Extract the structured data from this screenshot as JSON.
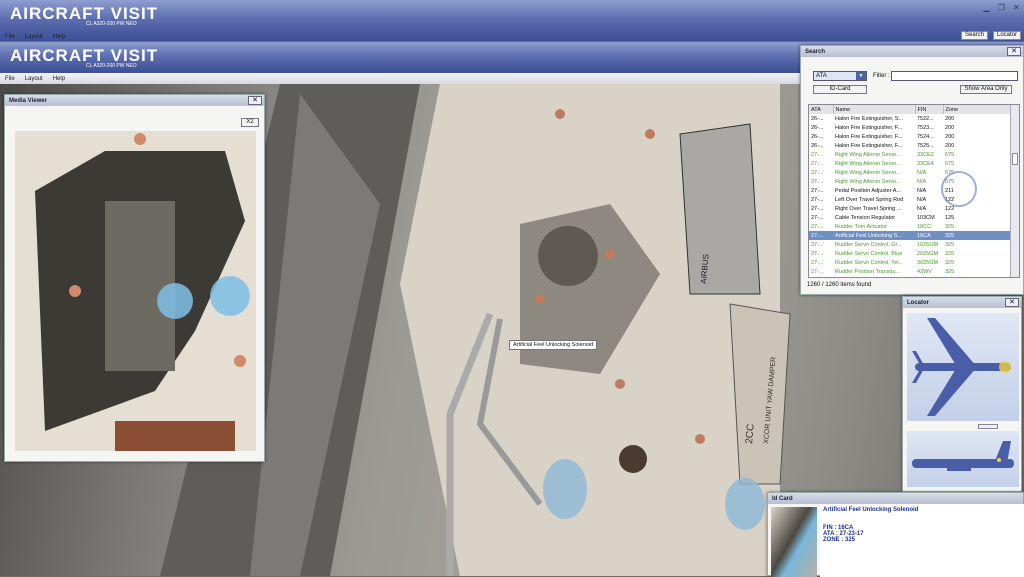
{
  "app": {
    "brand": "AIRCRAFT VISIT",
    "subtitle": "CL A320-200 PW NEO"
  },
  "menu": [
    "File",
    "Layout",
    "Help"
  ],
  "toolbar": {
    "search": "Search",
    "locator": "Locator"
  },
  "media_viewer": {
    "title": "Media Viewer",
    "zoom": "X2"
  },
  "tooltip": "Artificial Feel Unlocking Solenoid",
  "search": {
    "title": "Search",
    "ata_select": "ATA",
    "filter_label": "Filter :",
    "filter_value": "",
    "id_card": "ID-Card",
    "show_area": "Show Area Only",
    "columns": [
      "ATA",
      "Name",
      "FIN",
      "Zone"
    ],
    "rows": [
      [
        "26-...",
        "Halon Fire Extinguisher, S...",
        "7522...",
        "200",
        "n"
      ],
      [
        "26-...",
        "Halon Fire Extinguisher, F...",
        "7523...",
        "200",
        "n"
      ],
      [
        "26-...",
        "Halon Fire Extinguisher, F...",
        "7524...",
        "200",
        "n"
      ],
      [
        "26-...",
        "Halon Fire Extinguisher, F...",
        "7525...",
        "200",
        "n"
      ],
      [
        "27-...",
        "Right Wing Aileron Servo...",
        "33CE2",
        "675",
        "g"
      ],
      [
        "27-...",
        "Right Wing Aileron Servo...",
        "33CE4",
        "675",
        "g"
      ],
      [
        "27-...",
        "Right Wing Aileron Servo...",
        "N/A",
        "675",
        "g"
      ],
      [
        "27-...",
        "Right Wing Aileron Servo...",
        "N/A",
        "675",
        "g"
      ],
      [
        "27-...",
        "Pedal Position Adjuster A...",
        "N/A",
        "211",
        "n"
      ],
      [
        "27-...",
        "Left Over Travel Spring Rod",
        "N/A",
        "122",
        "n"
      ],
      [
        "27-...",
        "Right Over Travel Spring ...",
        "N/A",
        "122",
        "n"
      ],
      [
        "27-...",
        "Cable Tension Regulator",
        "103CM",
        "125",
        "n"
      ],
      [
        "27-...",
        "Rudder Trim Actuator",
        "10CC",
        "325",
        "g"
      ],
      [
        "27-...",
        "Artificial Feel Unlocking S...",
        "16CA",
        "325",
        "s"
      ],
      [
        "27-...",
        "Rudder Servo Control, Gr...",
        "1025GM",
        "325",
        "g"
      ],
      [
        "27-...",
        "Rudder Servo Control, Blue",
        "2025GM",
        "325",
        "g"
      ],
      [
        "27-...",
        "Rudder Servo Control, Yel...",
        "3025GM",
        "325",
        "g"
      ],
      [
        "27-...",
        "Rudder Position Transdu...",
        "42WV",
        "325",
        "g"
      ]
    ],
    "footer": "1260 / 1260 items found"
  },
  "locator": {
    "title": "Locator"
  },
  "idcard": {
    "title": "Id Card",
    "name": "Artificial Feel Unlocking Solenoid",
    "fin": "FIN : 16CA",
    "ata": "ATA : 27-23-17",
    "zone": "ZONE : 325"
  },
  "plate": {
    "brand": "AIRBUS",
    "code": "2CC",
    "label": "XCOR UNIT YAW DAMPER"
  }
}
